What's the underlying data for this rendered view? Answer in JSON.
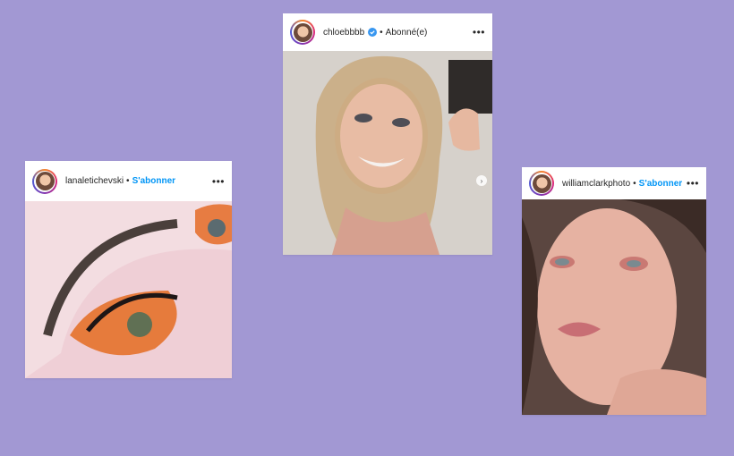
{
  "posts": [
    {
      "username": "lanaletichevski",
      "separator": "•",
      "action": "S'abonner",
      "action_type": "follow",
      "more_icon": "three-dots-icon",
      "verified": false
    },
    {
      "username": "chloebbbb",
      "separator": "•",
      "action": "Abonné(e)",
      "action_type": "following",
      "more_icon": "three-dots-icon",
      "verified": true
    },
    {
      "username": "williamclarkphoto",
      "separator": "•",
      "action": "S'abonner",
      "action_type": "follow",
      "more_icon": "three-dots-icon",
      "verified": false
    }
  ],
  "colors": {
    "background": "#a298d3",
    "follow_blue": "#0095f6",
    "text": "#262626"
  }
}
